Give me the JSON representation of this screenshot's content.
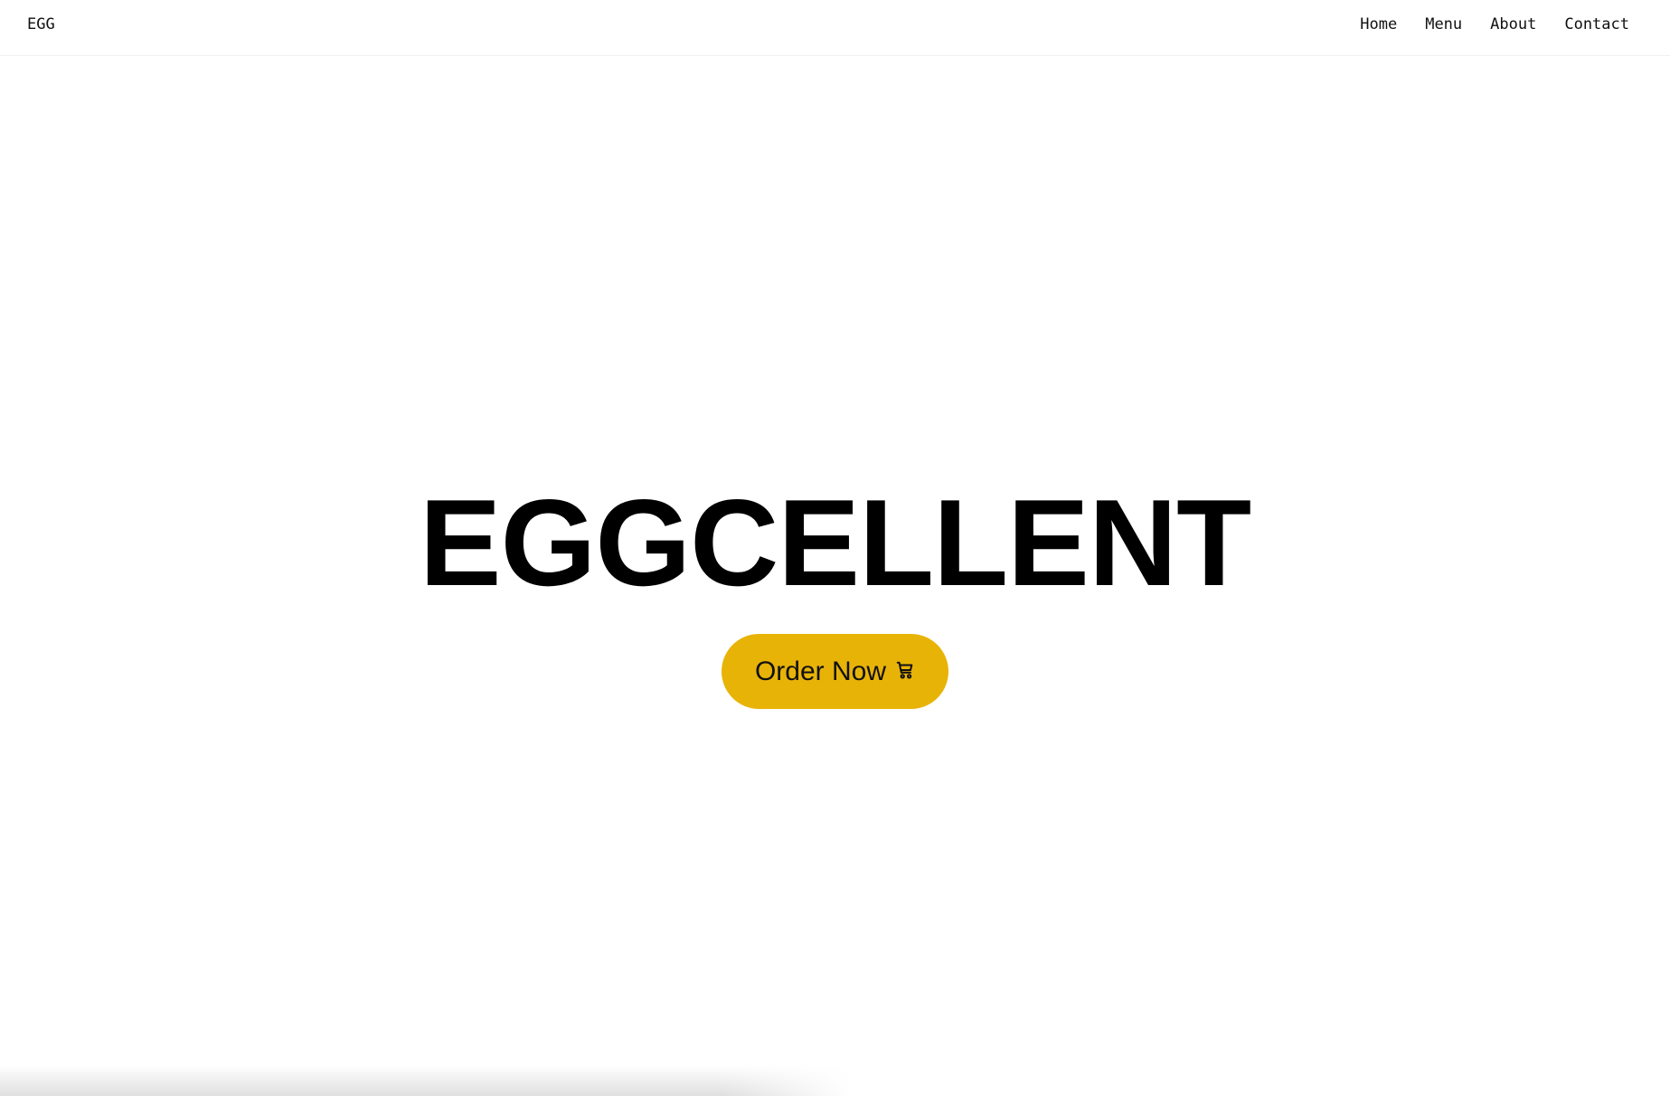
{
  "nav": {
    "logo": "EGG",
    "links": [
      "Home",
      "Menu",
      "About",
      "Contact"
    ]
  },
  "hero": {
    "title": "EGGCELLENT",
    "cta_label": "Order Now",
    "cta_icon": "cart-icon",
    "cta_color": "#e8b307"
  }
}
